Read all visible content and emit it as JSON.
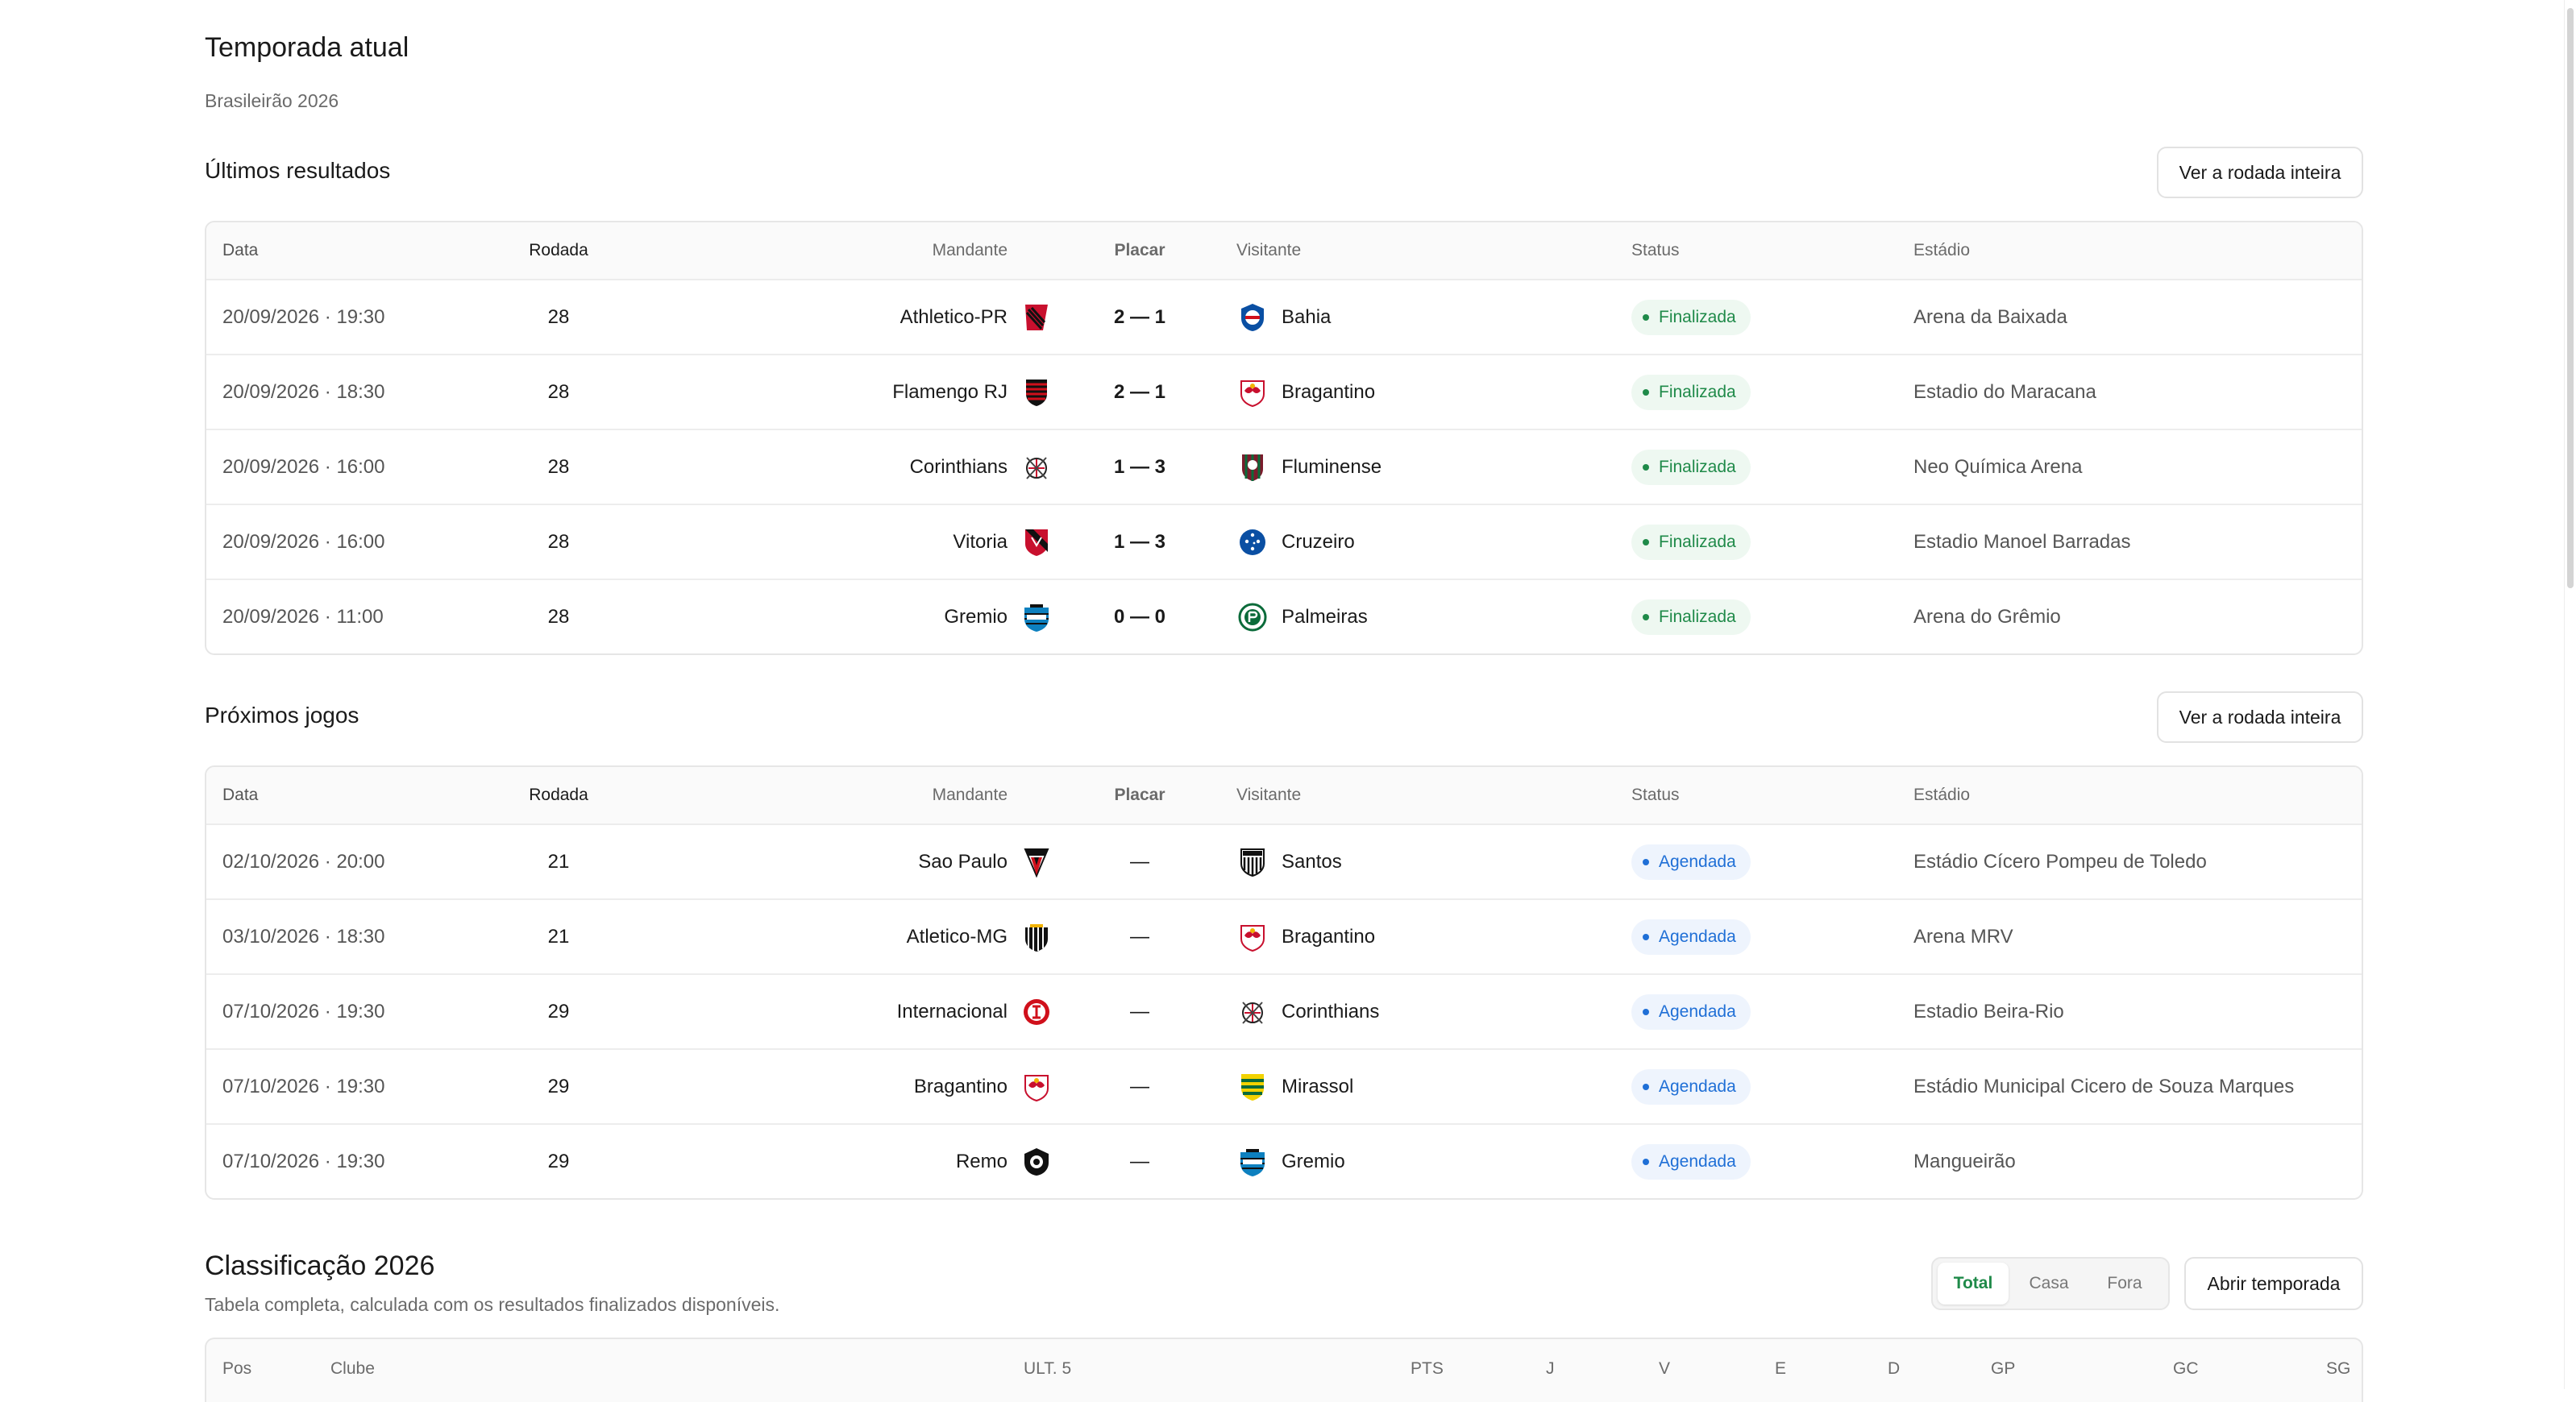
{
  "header": {
    "title": "Temporada atual",
    "subtitle": "Brasileirão 2026"
  },
  "columns": {
    "date": "Data",
    "round": "Rodada",
    "home": "Mandante",
    "score": "Placar",
    "away": "Visitante",
    "status": "Status",
    "stadium": "Estádio"
  },
  "results": {
    "title": "Últimos resultados",
    "button": "Ver a rodada inteira",
    "rows": [
      {
        "date": "20/09/2026 · 19:30",
        "round": "28",
        "home": "Athletico-PR",
        "home_icon": "athletico-crest-icon",
        "score": "2 — 1",
        "away": "Bahia",
        "away_icon": "bahia-crest-icon",
        "status": "Finalizada",
        "stadium": "Arena da Baixada"
      },
      {
        "date": "20/09/2026 · 18:30",
        "round": "28",
        "home": "Flamengo RJ",
        "home_icon": "flamengo-crest-icon",
        "score": "2 — 1",
        "away": "Bragantino",
        "away_icon": "bragantino-crest-icon",
        "status": "Finalizada",
        "stadium": "Estadio do Maracana"
      },
      {
        "date": "20/09/2026 · 16:00",
        "round": "28",
        "home": "Corinthians",
        "home_icon": "corinthians-crest-icon",
        "score": "1 — 3",
        "away": "Fluminense",
        "away_icon": "fluminense-crest-icon",
        "status": "Finalizada",
        "stadium": "Neo Química Arena"
      },
      {
        "date": "20/09/2026 · 16:00",
        "round": "28",
        "home": "Vitoria",
        "home_icon": "vitoria-crest-icon",
        "score": "1 — 3",
        "away": "Cruzeiro",
        "away_icon": "cruzeiro-crest-icon",
        "status": "Finalizada",
        "stadium": "Estadio Manoel Barradas"
      },
      {
        "date": "20/09/2026 · 11:00",
        "round": "28",
        "home": "Gremio",
        "home_icon": "gremio-crest-icon",
        "score": "0 — 0",
        "away": "Palmeiras",
        "away_icon": "palmeiras-crest-icon",
        "status": "Finalizada",
        "stadium": "Arena do Grêmio"
      }
    ]
  },
  "upcoming": {
    "title": "Próximos jogos",
    "button": "Ver a rodada inteira",
    "rows": [
      {
        "date": "02/10/2026 · 20:00",
        "round": "21",
        "home": "Sao Paulo",
        "home_icon": "sao-paulo-crest-icon",
        "score": "—",
        "away": "Santos",
        "away_icon": "santos-crest-icon",
        "status": "Agendada",
        "stadium": "Estádio Cícero Pompeu de Toledo"
      },
      {
        "date": "03/10/2026 · 18:30",
        "round": "21",
        "home": "Atletico-MG",
        "home_icon": "atletico-mg-crest-icon",
        "score": "—",
        "away": "Bragantino",
        "away_icon": "bragantino-crest-icon",
        "status": "Agendada",
        "stadium": "Arena MRV"
      },
      {
        "date": "07/10/2026 · 19:30",
        "round": "29",
        "home": "Internacional",
        "home_icon": "internacional-crest-icon",
        "score": "—",
        "away": "Corinthians",
        "away_icon": "corinthians-crest-icon",
        "status": "Agendada",
        "stadium": "Estadio Beira-Rio"
      },
      {
        "date": "07/10/2026 · 19:30",
        "round": "29",
        "home": "Bragantino",
        "home_icon": "bragantino-crest-icon",
        "score": "—",
        "away": "Mirassol",
        "away_icon": "mirassol-crest-icon",
        "status": "Agendada",
        "stadium": "Estádio Municipal Cicero de Souza Marques"
      },
      {
        "date": "07/10/2026 · 19:30",
        "round": "29",
        "home": "Remo",
        "home_icon": "remo-crest-icon",
        "score": "—",
        "away": "Gremio",
        "away_icon": "gremio-crest-icon",
        "status": "Agendada",
        "stadium": "Mangueirão"
      }
    ]
  },
  "standings": {
    "title": "Classificação 2026",
    "subtitle": "Tabela completa, calculada com os resultados finalizados disponíveis.",
    "tabs": [
      "Total",
      "Casa",
      "Fora"
    ],
    "active_tab": "Total",
    "open_button": "Abrir temporada",
    "columns": [
      "Pos",
      "Clube",
      "ULT. 5",
      "PTS",
      "J",
      "V",
      "E",
      "D",
      "GP",
      "GC",
      "SG"
    ]
  },
  "colors": {
    "finalizada": "#1f8a49",
    "agendada": "#1f6fd6",
    "border": "#e6e6e6"
  }
}
